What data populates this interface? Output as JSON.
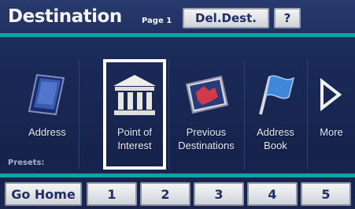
{
  "header": {
    "title": "Destination",
    "page_indicator": "Page 1",
    "del_dest_label": "Del.Dest.",
    "help_label": "?"
  },
  "options": [
    {
      "label_line1": "Address",
      "label_line2": "",
      "icon": "address-book-icon"
    },
    {
      "label_line1": "Point of",
      "label_line2": "Interest",
      "icon": "building-columns-icon",
      "selected": true
    },
    {
      "label_line1": "Previous",
      "label_line2": "Destinations",
      "icon": "map-icon"
    },
    {
      "label_line1": "Address",
      "label_line2": "Book",
      "icon": "flag-icon"
    },
    {
      "label_line1": "More",
      "label_line2": "",
      "icon": "arrow-right-icon"
    }
  ],
  "presets": {
    "label": "Presets:",
    "buttons": [
      "Go Home",
      "1",
      "2",
      "3",
      "4",
      "5"
    ]
  },
  "colors": {
    "background": "#1a2a58",
    "accent_line": "#12a3a6",
    "button_text": "#1f2f63",
    "selection_border": "#ffffff"
  }
}
